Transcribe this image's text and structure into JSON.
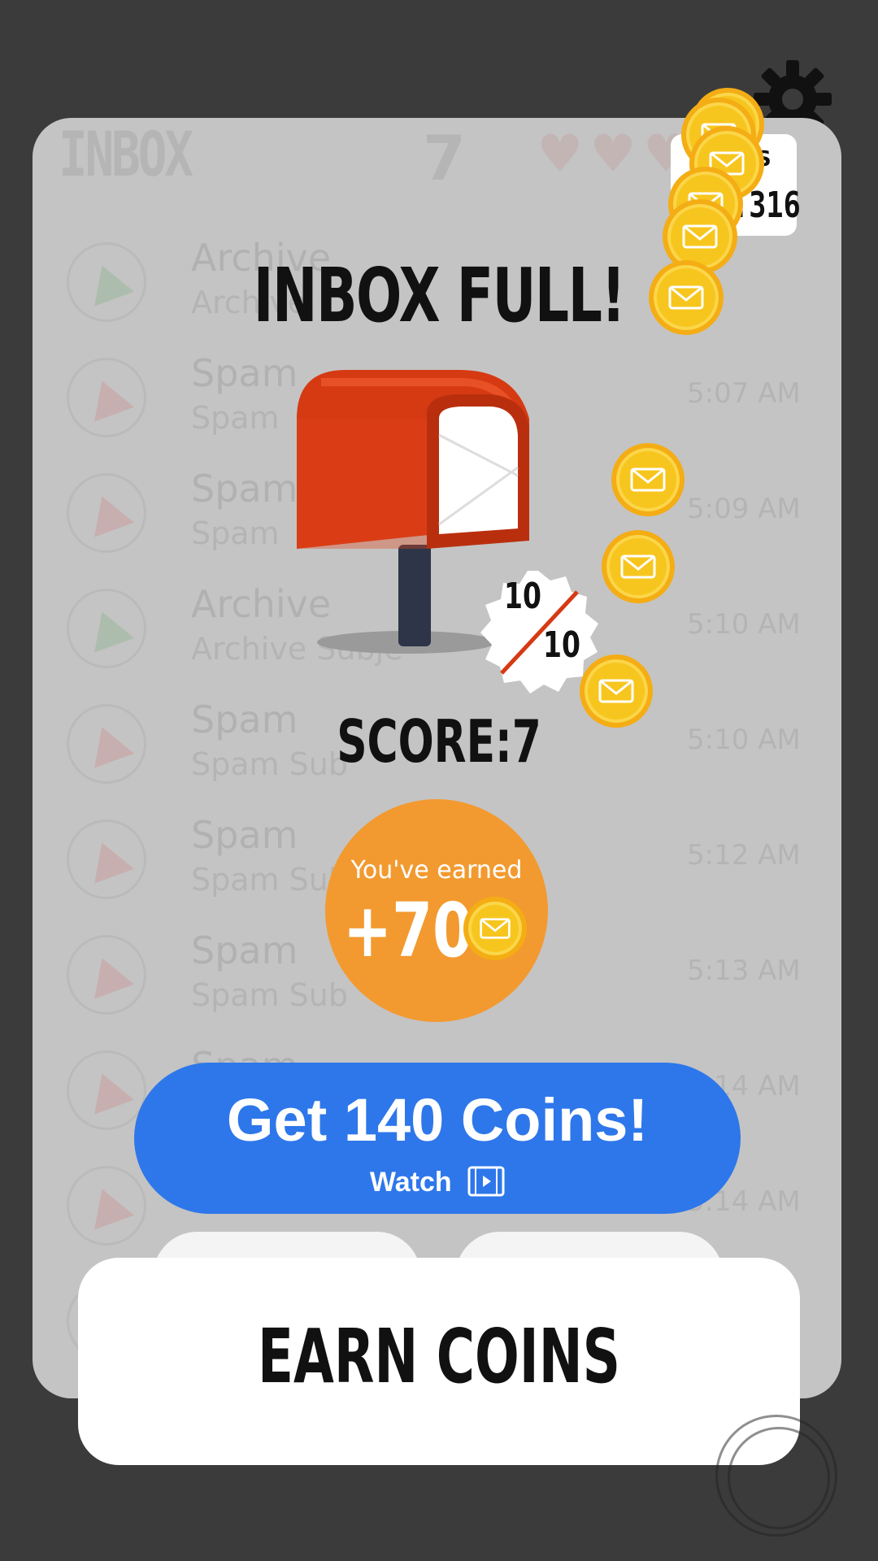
{
  "background": {
    "list": [
      {
        "folder": "Archive",
        "subject": "Archive",
        "time": ""
      },
      {
        "folder": "Spam",
        "subject": "Spam",
        "time": "5:07 AM"
      },
      {
        "folder": "Spam",
        "subject": "Spam",
        "time": "5:09 AM"
      },
      {
        "folder": "Archive",
        "subject": "Archive Subje",
        "time": "5:10 AM"
      },
      {
        "folder": "Spam",
        "subject": "Spam Sub",
        "time": "5:10 AM"
      },
      {
        "folder": "Spam",
        "subject": "Spam Sub",
        "time": "5:12 AM"
      },
      {
        "folder": "Spam",
        "subject": "Spam Sub",
        "time": "5:13 AM"
      },
      {
        "folder": "Spam",
        "subject": "",
        "time": "5:14 AM"
      },
      {
        "folder": "",
        "subject": "",
        "time": "5:14 AM"
      },
      {
        "folder": "",
        "subject": "",
        "time": ""
      }
    ],
    "header": {
      "title": "INBOX",
      "score": "7",
      "hearts": "♥♥♥"
    }
  },
  "coins_counter": {
    "label": "S",
    "value": ".316"
  },
  "modal": {
    "title": "INBOX FULL!",
    "badge_top": "10",
    "badge_bottom": "10",
    "score_label": "SCORE:7",
    "earned_label": "You've earned",
    "earned_value": "+70",
    "watch_button_label": "Get 140 Coins!",
    "watch_button_sub": "Watch"
  },
  "earn_coins_label": "EARN COINS",
  "colors": {
    "accent_blue": "#2e77ea",
    "earned_orange": "#f29a30",
    "coin_gold": "#f7c61e",
    "mailbox_red": "#e3451b",
    "modal_bg": "#c4c4c4"
  }
}
